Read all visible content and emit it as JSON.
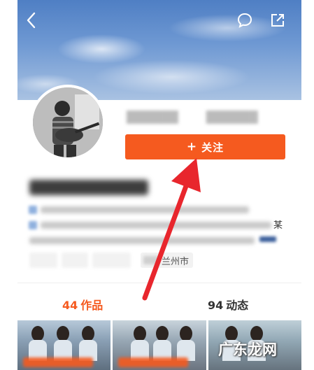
{
  "header": {
    "back_icon": "chevron-left-icon",
    "message_icon": "chat-bubble-icon",
    "share_icon": "share-out-icon"
  },
  "profile": {
    "follow_button_label": "关注",
    "follow_button_icon": "+",
    "side_char": "某",
    "location": "兰州市"
  },
  "tabs": {
    "works_count": "44",
    "works_label": "作品",
    "dynamics_count": "94",
    "dynamics_label": "动态"
  },
  "watermark": "广东龙网",
  "colors": {
    "accent": "#f55a1f",
    "arrow": "#e8262d"
  }
}
